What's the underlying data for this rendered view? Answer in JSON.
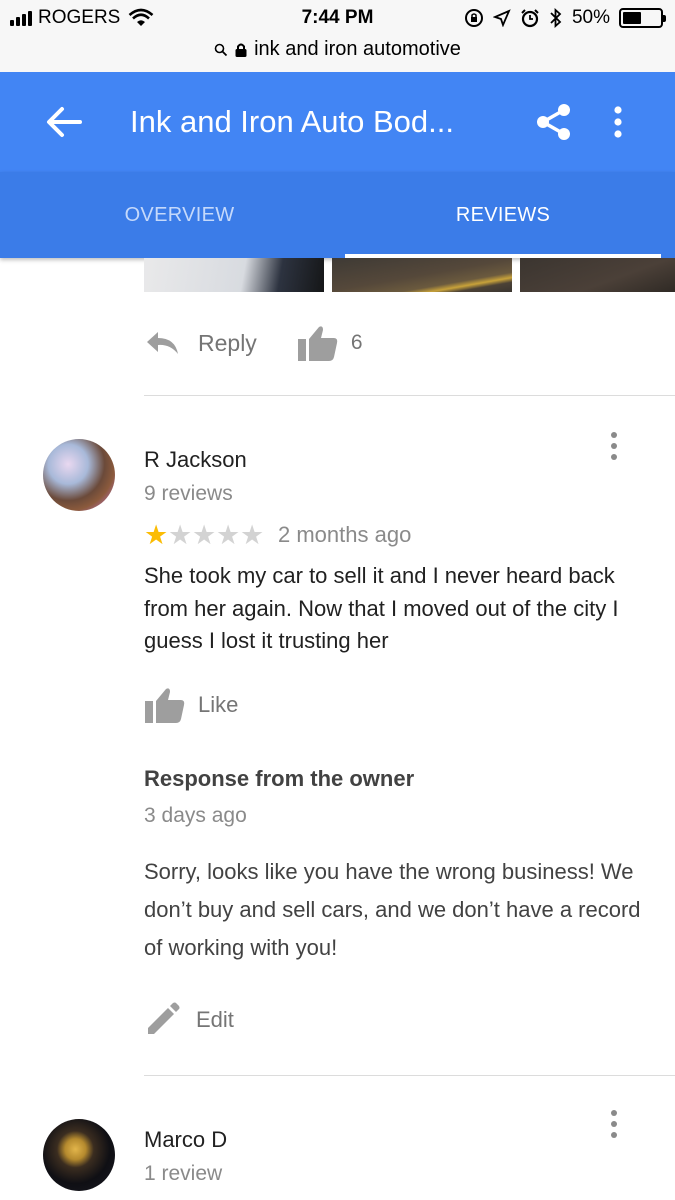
{
  "status_bar": {
    "carrier": "ROGERS",
    "time": "7:44 PM",
    "battery_percent": "50%",
    "battery_level": 0.5
  },
  "url_bar": {
    "url_text": "ink and iron automotive"
  },
  "app_bar": {
    "title": "Ink and Iron Auto Bod...",
    "color": "#4285f4"
  },
  "tabs": [
    {
      "label": "OVERVIEW",
      "selected": false
    },
    {
      "label": "REVIEWS",
      "selected": true
    }
  ],
  "previous_review": {
    "reply_label": "Reply",
    "like_count": "6"
  },
  "reviews": [
    {
      "author": "R Jackson",
      "review_count": "9 reviews",
      "rating": 1,
      "max_rating": 5,
      "date": "2 months ago",
      "text": "She took my car to sell it and I never heard back from her again. Now that I moved out of the city I guess I lost it trusting her",
      "like_label": "Like",
      "owner_response": {
        "title": "Response from the owner",
        "date": "3 days ago",
        "text": "Sorry, looks like you have the wrong business! We don’t buy and sell cars, and we don’t have a record of working with you!",
        "edit_label": "Edit"
      }
    },
    {
      "author": "Marco D",
      "review_count": "1 review"
    }
  ],
  "colors": {
    "star_filled": "#fbbc04",
    "star_empty": "#d3d3d3",
    "tab_bar": "#3b7ce8"
  }
}
